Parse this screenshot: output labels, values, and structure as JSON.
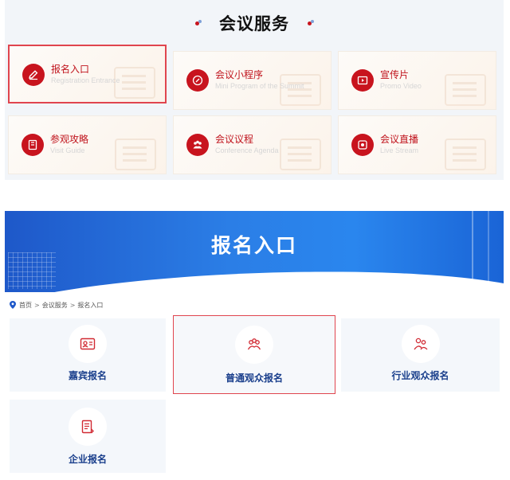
{
  "services": {
    "title": "会议服务",
    "items": [
      {
        "cn": "报名入口",
        "en": "Registration Entrance",
        "icon": "pen-icon",
        "selected": true
      },
      {
        "cn": "会议小程序",
        "en": "Mini Program of the Summit",
        "icon": "link-icon",
        "selected": false
      },
      {
        "cn": "宣传片",
        "en": "Promo Video",
        "icon": "video-icon",
        "selected": false
      },
      {
        "cn": "参观攻略",
        "en": "Visit Guide",
        "icon": "book-icon",
        "selected": false
      },
      {
        "cn": "会议议程",
        "en": "Conference Agenda",
        "icon": "people-icon",
        "selected": false
      },
      {
        "cn": "会议直播",
        "en": "Live Stream",
        "icon": "live-icon",
        "selected": false
      }
    ]
  },
  "banner": {
    "title": "报名入口"
  },
  "breadcrumb": {
    "items": [
      "首页",
      "会议服务",
      "报名入口"
    ],
    "separator": ">"
  },
  "registration": {
    "items": [
      {
        "label": "嘉宾报名",
        "icon": "id-card-icon",
        "selected": false
      },
      {
        "label": "普通观众报名",
        "icon": "group-icon",
        "selected": true
      },
      {
        "label": "行业观众报名",
        "icon": "two-people-icon",
        "selected": false
      },
      {
        "label": "企业报名",
        "icon": "document-icon",
        "selected": false
      }
    ]
  },
  "colors": {
    "brand_red": "#c8141e",
    "highlight_border": "#e0454e",
    "banner_blue": "#2b7ee6",
    "label_blue": "#1a3f8c"
  }
}
